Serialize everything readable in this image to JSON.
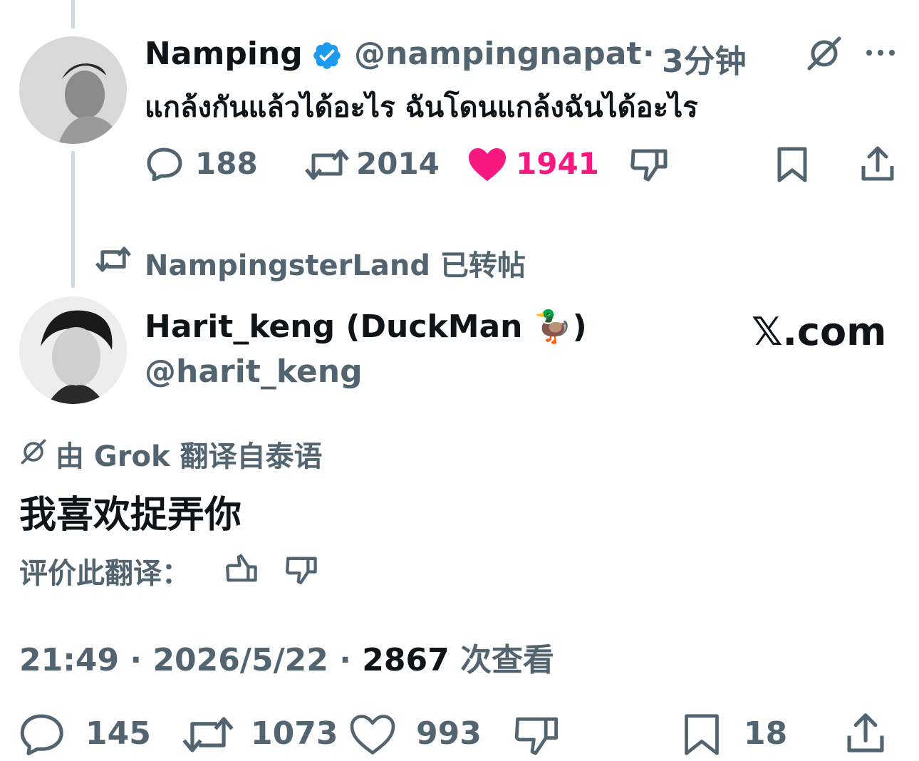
{
  "parent_tweet": {
    "display_name": "Namping",
    "handle": "@nampingnapat",
    "separator": "·",
    "time_ago": "3分钟",
    "text": "แกล้งกันแล้วได้อะไร ฉันโดนแกล้งฉันได้อะไร",
    "replies": "188",
    "retweets": "2014",
    "likes": "1941",
    "like_color": "#f91880"
  },
  "retweet_banner": {
    "label": "NampingsterLand 已转帖"
  },
  "main_tweet": {
    "display_name": "Harit_keng (DuckMan 🦆)",
    "handle": "@harit_keng",
    "watermark": "𝕏.com",
    "translation_note": "由 Grok 翻译自泰语",
    "text": "我喜欢捉弄你",
    "rate_label": "评价此翻译：",
    "timestamp": "21:49",
    "date": "2026/5/22",
    "dot": "·",
    "views": "2867",
    "views_label": "次查看",
    "replies": "145",
    "retweets": "1073",
    "likes": "993",
    "bookmarks": "18"
  },
  "colors": {
    "text_primary": "#0f1419",
    "text_secondary": "#536471",
    "verified": "#1d9bf0",
    "like": "#f91880",
    "thread_line": "#cfd9de"
  },
  "icons": [
    "verified-badge-icon",
    "grok-icon",
    "more-icon",
    "reply-icon",
    "retweet-icon",
    "like-icon",
    "dislike-icon",
    "bookmark-icon",
    "share-icon",
    "thumbs-up-icon"
  ]
}
